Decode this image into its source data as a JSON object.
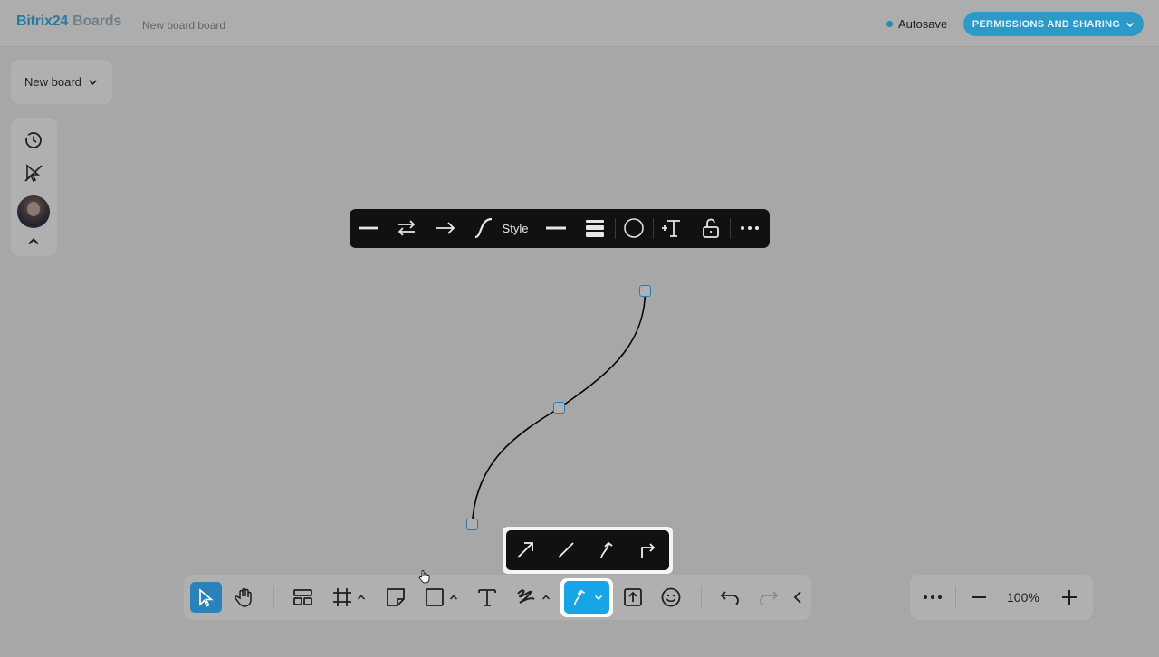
{
  "header": {
    "brand_primary": "Bitrix24",
    "brand_secondary": "Boards",
    "filename": "New board.board",
    "autosave_label": "Autosave",
    "permissions_label": "PERMISSIONS AND SHARING"
  },
  "board_menu": {
    "label": "New board"
  },
  "side_tools": [
    "history-icon",
    "hide-cursors-icon",
    "user-avatar",
    "chevron-up-icon"
  ],
  "context_toolbar": {
    "style_label": "Style",
    "items": [
      "line-start-icon",
      "swap-arrows-icon",
      "line-end-arrow-icon",
      "curve-type-icon",
      "line-style-icon",
      "line-weight-icon",
      "color-swatch",
      "add-text-icon",
      "lock-icon",
      "more-icon"
    ],
    "color": "#111111"
  },
  "connector_popup": {
    "items": [
      "straight-arrow-icon",
      "straight-line-icon",
      "curved-arrow-icon",
      "elbow-arrow-icon"
    ]
  },
  "bottom_toolbar": {
    "items": [
      "select-tool",
      "hand-tool",
      "templates-tool",
      "frame-tool",
      "sticky-note-tool",
      "shape-tool",
      "text-tool",
      "pen-tool",
      "connector-tool",
      "upload-tool",
      "emoji-tool",
      "undo",
      "redo",
      "collapse"
    ],
    "active": "select-tool",
    "accent": "#18a5e8"
  },
  "zoom": {
    "value": "100%"
  }
}
